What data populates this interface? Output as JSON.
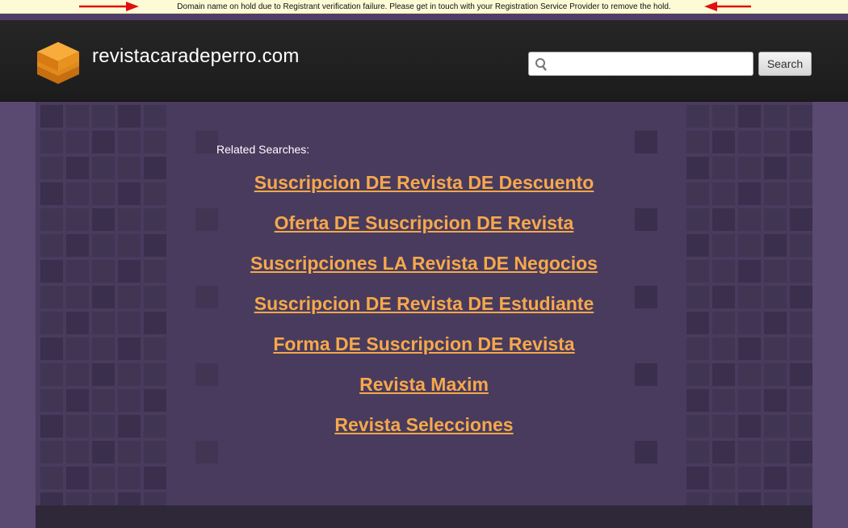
{
  "notice": {
    "text": "Domain name on hold due to Registrant verification failure. Please get in touch with your Registration Service Provider to remove the hold."
  },
  "header": {
    "site_title": "revistacaradeperro.com",
    "search_placeholder": "",
    "search_button_label": "Search"
  },
  "main": {
    "related_label": "Related Searches:",
    "links": [
      "Suscripcion DE Revista DE Descuento",
      "Oferta DE Suscripcion DE Revista",
      "Suscripciones LA Revista DE Negocios",
      "Suscripcion DE Revista DE Estudiante",
      "Forma DE Suscripcion DE Revista",
      "Revista Maxim",
      "Revista Selecciones"
    ]
  },
  "colors": {
    "link": "#f6a84b",
    "header_bg": "#1f1f1f",
    "page_bg": "#5a4a72",
    "content_bg": "#483b5e",
    "notice_bg": "#fdfbd6",
    "arrow": "#e01010"
  }
}
